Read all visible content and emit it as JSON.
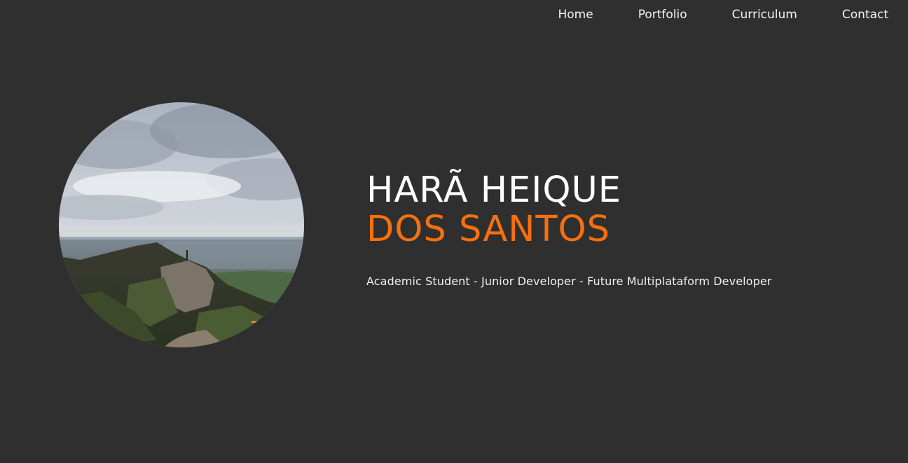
{
  "nav": {
    "items": [
      {
        "label": "Home"
      },
      {
        "label": "Portfolio"
      },
      {
        "label": "Curriculum"
      },
      {
        "label": "Contact"
      }
    ]
  },
  "hero": {
    "first_name": "HARÃ HEIQUE",
    "last_name": "DOS SANTOS",
    "tagline": "Academic Student - Junior Developer - Future Multiplataform Developer"
  },
  "colors": {
    "background": "#2f2f2f",
    "accent": "#f6700f",
    "text": "#ffffff"
  }
}
